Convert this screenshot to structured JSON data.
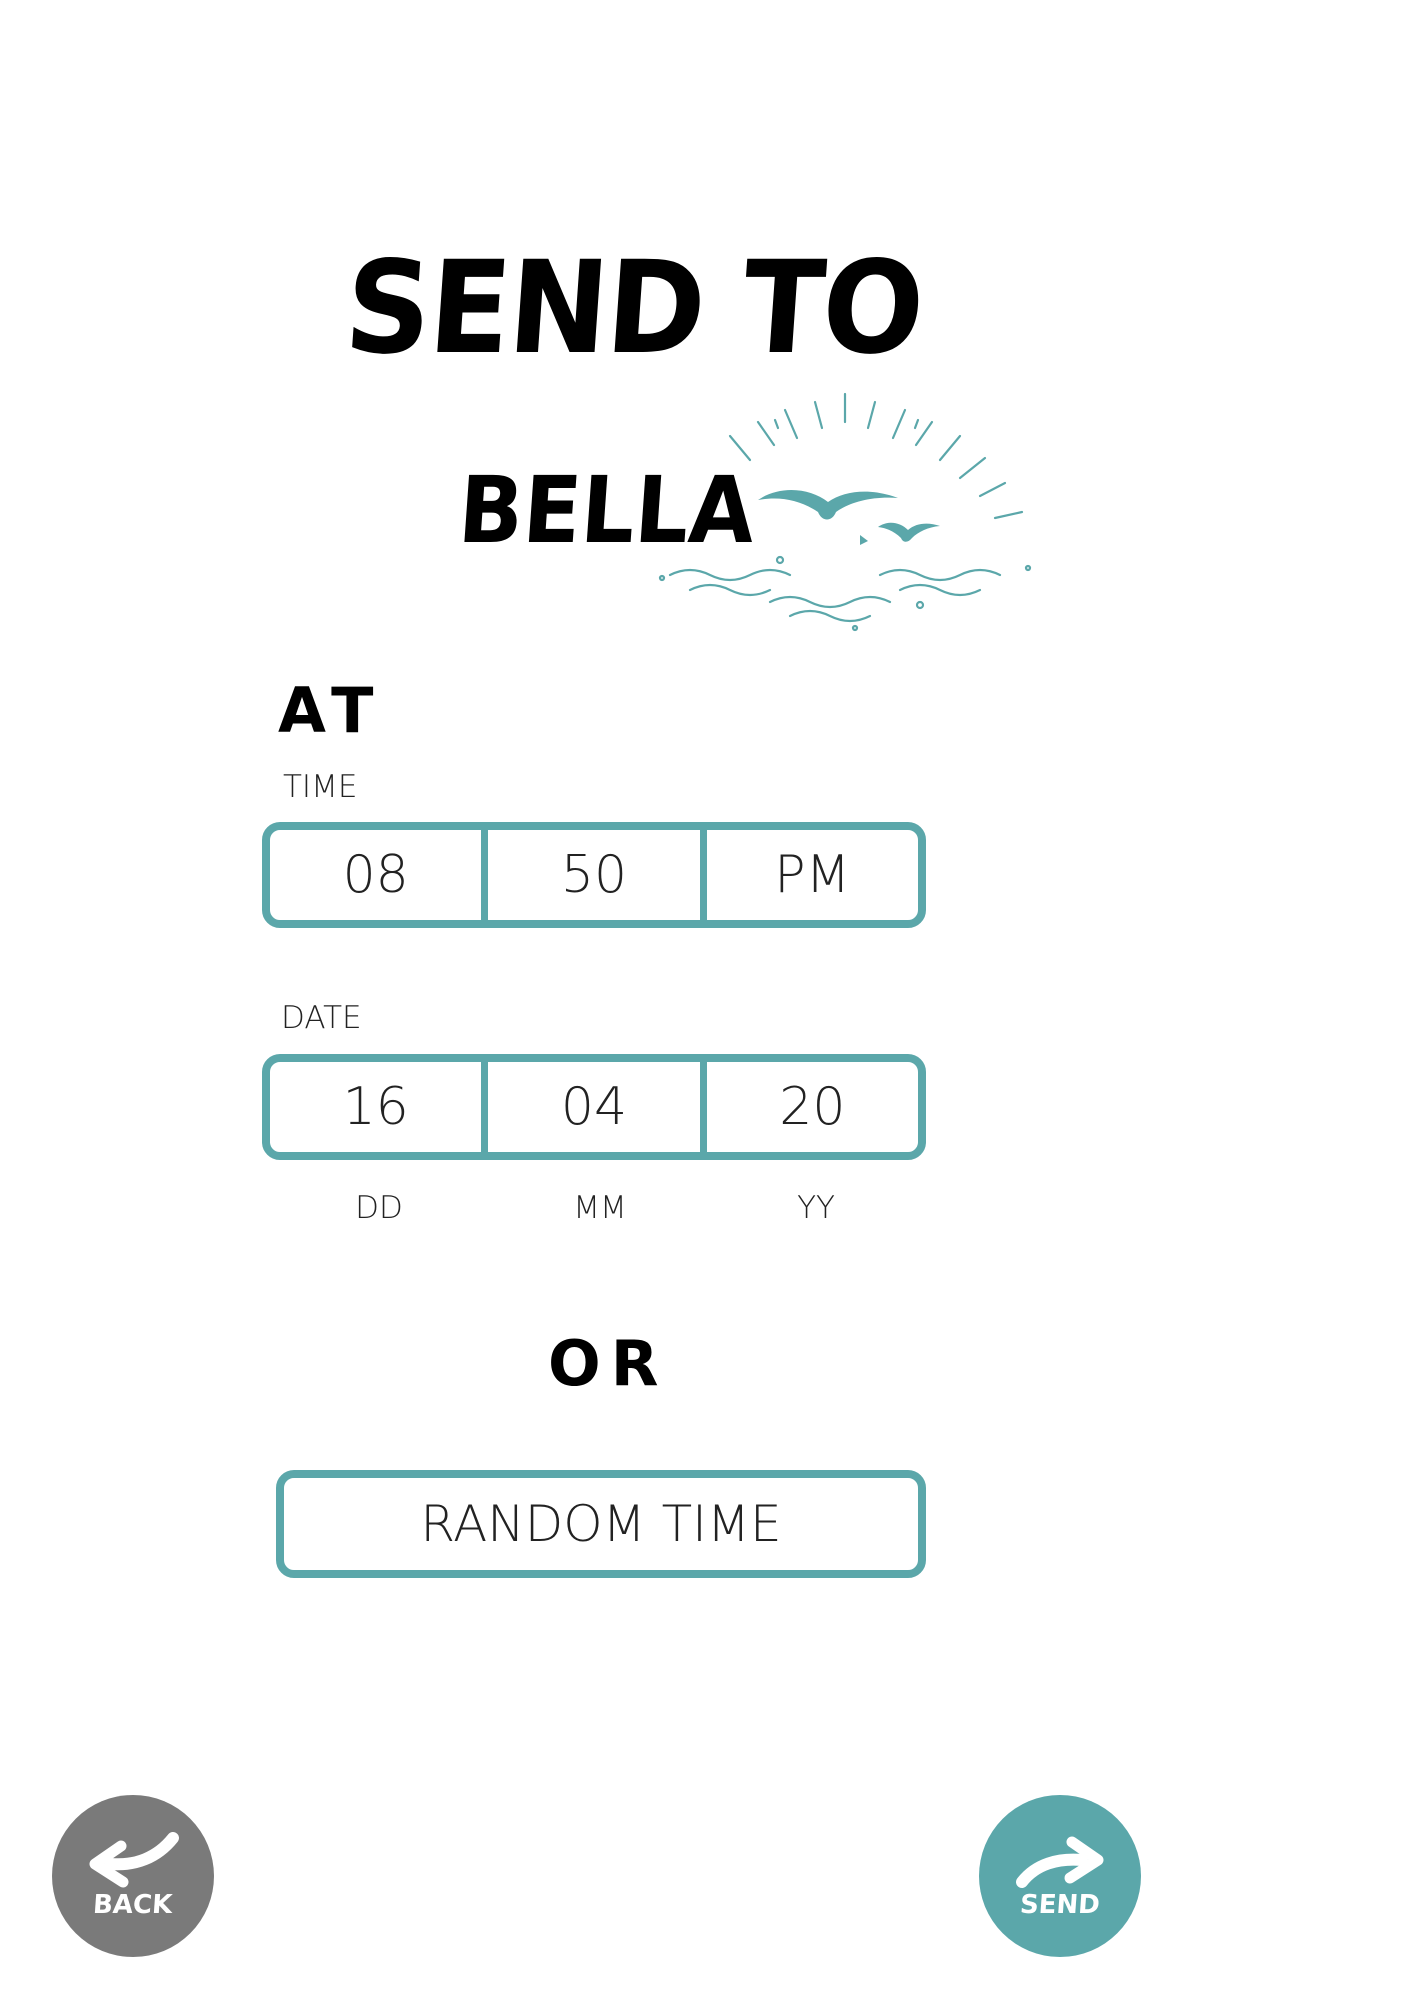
{
  "title": {
    "line1": "SEND TO",
    "recipient": "BELLA"
  },
  "at_heading": "AT",
  "time": {
    "label": "TIME",
    "hour": "08",
    "minute": "50",
    "meridiem": "PM"
  },
  "date": {
    "label": "DATE",
    "day": "16",
    "month": "04",
    "year": "20",
    "day_label": "DD",
    "month_label": "MM",
    "year_label": "YY"
  },
  "or_heading": "OR",
  "random_button": "RANDOM TIME",
  "back_button": {
    "label": "BACK",
    "icon": "arrow-back-icon",
    "color": "#7a7a7a"
  },
  "send_button": {
    "label": "SEND",
    "icon": "arrow-forward-icon",
    "color": "#5ba7aa"
  },
  "colors": {
    "accent": "#5ba7aa",
    "text": "#111111",
    "background": "#ffffff"
  },
  "decoration": {
    "icon": "seagulls-sunrise-icon"
  }
}
